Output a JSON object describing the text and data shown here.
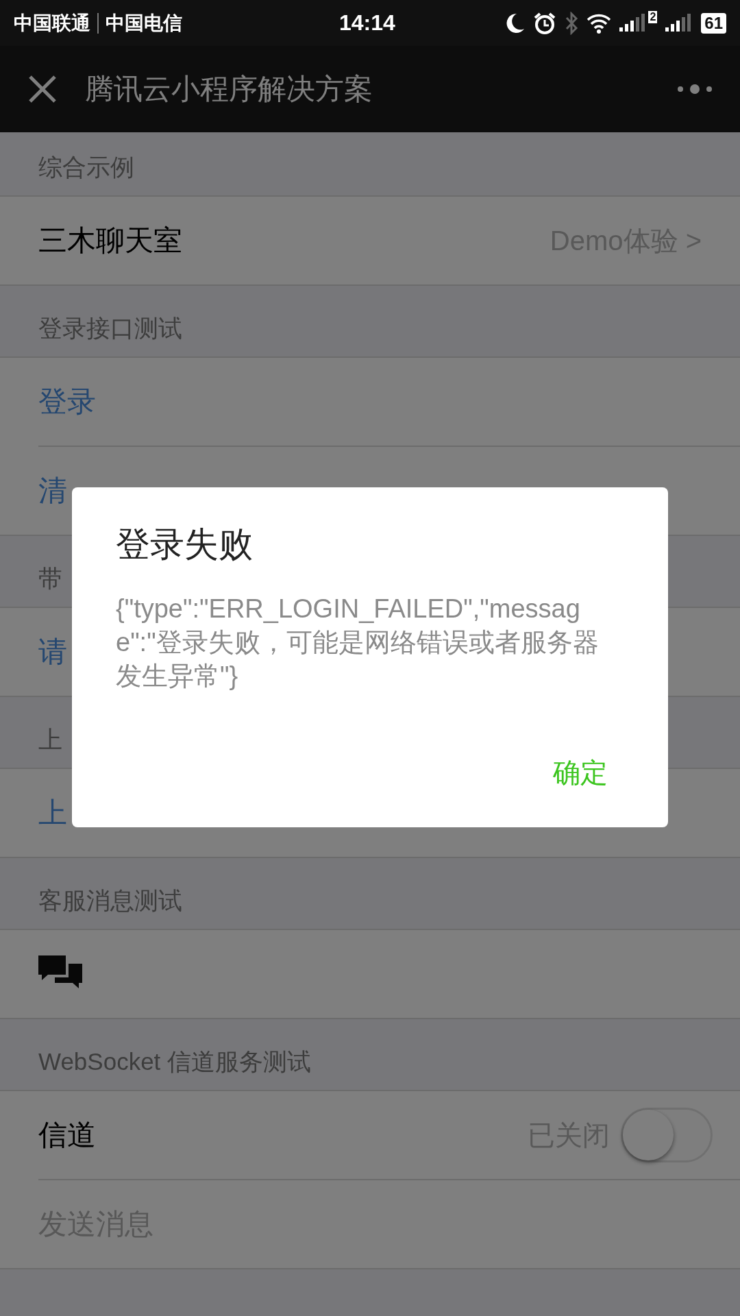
{
  "status_bar": {
    "carriers": [
      "中国联通",
      "中国电信"
    ],
    "time": "14:14",
    "sim_label": "2",
    "battery": "61"
  },
  "nav_bar": {
    "title": "腾讯云小程序解决方案"
  },
  "sections": [
    {
      "header": "综合示例",
      "rows": [
        {
          "kind": "detail",
          "label": "三木聊天室",
          "value": "Demo体验 >"
        }
      ]
    },
    {
      "header": "登录接口测试",
      "rows": [
        {
          "kind": "action",
          "label": "登录"
        },
        {
          "kind": "action",
          "label": "清"
        }
      ]
    },
    {
      "header": "带",
      "rows": [
        {
          "kind": "action",
          "label": "请"
        }
      ]
    },
    {
      "header": "上",
      "rows": [
        {
          "kind": "action",
          "label": "上"
        }
      ]
    },
    {
      "header": "客服消息测试",
      "rows": [
        {
          "kind": "icon"
        }
      ]
    },
    {
      "header": "WebSocket 信道服务测试",
      "rows": [
        {
          "kind": "switch",
          "label": "信道",
          "value": "已关闭",
          "on": false
        },
        {
          "kind": "disabled",
          "label": "发送消息"
        }
      ]
    }
  ],
  "dialog": {
    "title": "登录失败",
    "message": "{\"type\":\"ERR_LOGIN_FAILED\",\"message\":\"登录失败，可能是网络错误或者服务器发生异常\"}",
    "button": "确定"
  }
}
